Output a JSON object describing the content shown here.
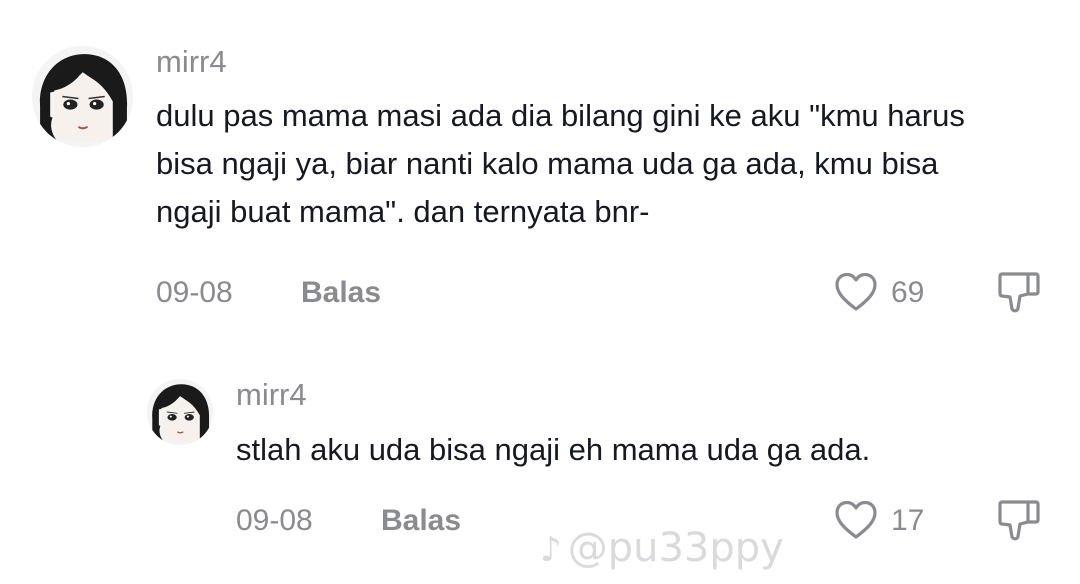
{
  "comments": [
    {
      "username": "mirr4",
      "lines": [
        "dulu pas mama masi ada dia bilang gini ke aku \"kmu harus",
        "bisa ngaji ya, biar nanti kalo mama uda ga ada, kmu bisa",
        "ngaji buat mama\". dan ternyata bnr-"
      ],
      "date": "09-08",
      "reply_label": "Balas",
      "likes": "69"
    },
    {
      "username": "mirr4",
      "lines": [
        "stlah aku uda bisa ngaji eh mama uda ga ada."
      ],
      "date": "09-08",
      "reply_label": "Balas",
      "likes": "17"
    }
  ],
  "watermark": {
    "logo_icon": "tiktok-logo-icon",
    "handle": "@pu33ppy"
  },
  "icons": {
    "like": "heart-outline-icon",
    "dislike": "thumbs-down-icon"
  },
  "colors": {
    "text": "#161823",
    "muted": "#8a8b91",
    "background": "#ffffff"
  }
}
